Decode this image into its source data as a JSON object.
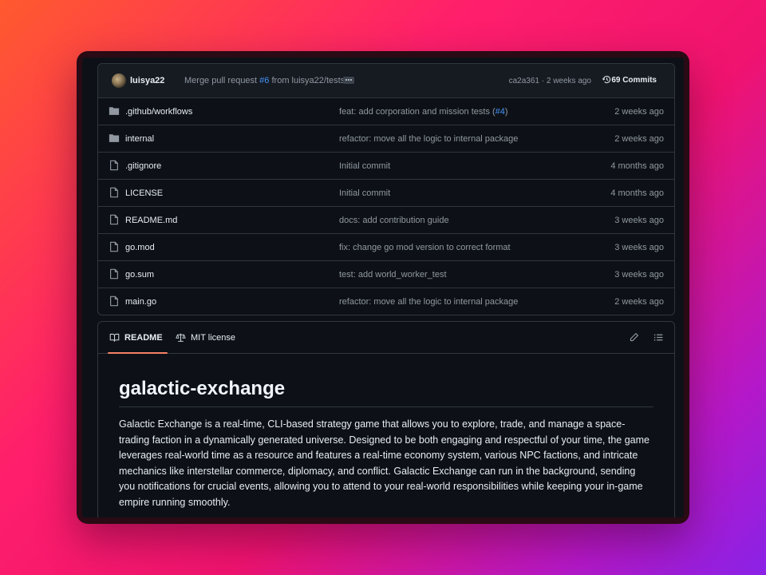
{
  "commit": {
    "author": "luisya22",
    "message_prefix": "Merge pull request",
    "pr_link": "#6",
    "message_suffix": "from luisya22/tests",
    "sha_time": "ca2a361 · 2 weeks ago",
    "commits_count": "69 Commits"
  },
  "files": [
    {
      "type": "folder",
      "name": ".github/workflows",
      "message": "feat: add corporation and mission tests (",
      "link": "#4",
      "message_end": ")",
      "date": "2 weeks ago"
    },
    {
      "type": "folder",
      "name": "internal",
      "message": "refactor: move all the logic to internal package",
      "link": "",
      "message_end": "",
      "date": "2 weeks ago"
    },
    {
      "type": "file",
      "name": ".gitignore",
      "message": "Initial commit",
      "link": "",
      "message_end": "",
      "date": "4 months ago"
    },
    {
      "type": "file",
      "name": "LICENSE",
      "message": "Initial commit",
      "link": "",
      "message_end": "",
      "date": "4 months ago"
    },
    {
      "type": "file",
      "name": "README.md",
      "message": "docs: add contribution guide",
      "link": "",
      "message_end": "",
      "date": "3 weeks ago"
    },
    {
      "type": "file",
      "name": "go.mod",
      "message": "fix: change go mod version to correct format",
      "link": "",
      "message_end": "",
      "date": "3 weeks ago"
    },
    {
      "type": "file",
      "name": "go.sum",
      "message": "test: add world_worker_test",
      "link": "",
      "message_end": "",
      "date": "3 weeks ago"
    },
    {
      "type": "file",
      "name": "main.go",
      "message": "refactor: move all the logic to internal package",
      "link": "",
      "message_end": "",
      "date": "2 weeks ago"
    }
  ],
  "readme": {
    "tab_readme": "README",
    "tab_license": "MIT license",
    "title": "galactic-exchange",
    "body": "Galactic Exchange is a real-time, CLI-based strategy game that allows you to explore, trade, and manage a space-trading faction in a dynamically generated universe. Designed to be both engaging and respectful of your time, the game leverages real-world time as a resource and features a real-time economy system, various NPC factions, and intricate mechanics like interstellar commerce, diplomacy, and conflict. Galactic Exchange can run in the background, sending you notifications for crucial events, allowing you to attend to your real-world responsibilities while keeping your in-game empire running smoothly."
  },
  "icons": {
    "folder": "folder-icon",
    "file": "file-icon",
    "book": "book-icon",
    "law": "scale-icon",
    "pencil": "pencil-icon",
    "list": "list-icon",
    "history": "history-icon"
  },
  "colors": {
    "background": "#0d1117",
    "link": "#4493f8",
    "tab_underline": "#f78166",
    "muted_text": "#9198a1"
  }
}
